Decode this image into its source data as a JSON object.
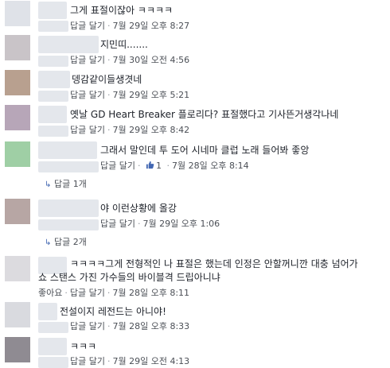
{
  "actions": {
    "reply": "답글 달기",
    "like": "좋아요",
    "dot": "·"
  },
  "comments": [
    {
      "text": "그게 표절이잖아 ㅋㅋㅋㅋ",
      "time": "7월 29일 오후 8:27"
    },
    {
      "text": "지민띠.......",
      "time": "7월 30일 오전 4:56"
    },
    {
      "text": "뎅감같이들생겻네",
      "time": "7월 29일 오후 5:21"
    },
    {
      "text": "옛날 GD Heart Breaker 플로리다? 표절했다고 기사뜬거생각나네",
      "time": "7월 29일 오후 8:42"
    },
    {
      "text": "그래서 말인데 투 도어 시네마 클럽 노래 들어봐 좋앙",
      "likes": "1",
      "time": "7월 28일 오후 8:14",
      "replies": "답글 1개"
    },
    {
      "text": "야 이런상황에 올강",
      "time": "7월 29일 오후 1:06",
      "replies": "답글 2개"
    },
    {
      "text": "ㅋㅋㅋㅋ그게 전형적인 나 표절은 했는데 인정은 안할꺼니깐 대충 넘어가",
      "text2": "쇼 스탠스 가진 가수들의 바이블격 드립아니냐",
      "time": "7월 28일 오후 8:11"
    },
    {
      "text": "전설이지 레전드는 아니야!",
      "time": "7월 28일 오후 8:33"
    },
    {
      "text": "ㅋㅋㅋ",
      "time": "7월 29일 오전 4:13"
    }
  ]
}
